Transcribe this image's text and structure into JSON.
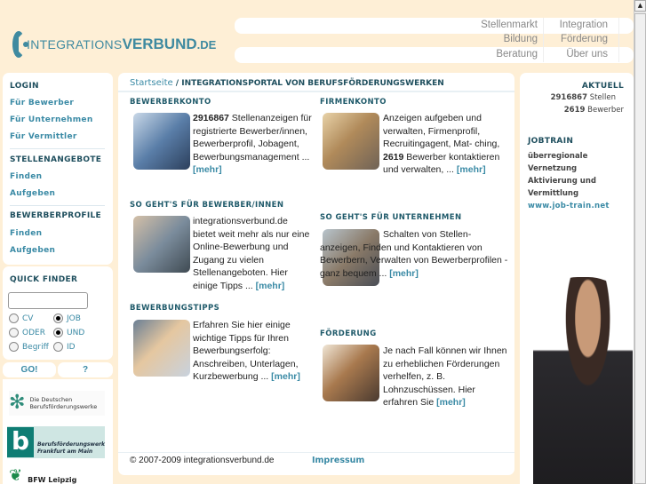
{
  "header": {
    "logo": {
      "part1": "INTEGRATIONS",
      "part2": "VERBUND",
      "part3": ".DE"
    },
    "nav": [
      [
        "Stellenmarkt",
        "Integration"
      ],
      [
        "Bildung",
        "Förderung"
      ],
      [
        "Beratung",
        "Über uns"
      ]
    ]
  },
  "sidebar": {
    "login_heading": "LOGIN",
    "login_links": [
      "Für Bewerber",
      "Für Unternehmen",
      "Für Vermittler"
    ],
    "stellen_heading": "STELLENANGEBOTE",
    "stellen_links": [
      "Finden",
      "Aufgeben"
    ],
    "profile_heading": "BEWERBERPROFILE",
    "profile_links": [
      "Finden",
      "Aufgeben"
    ]
  },
  "quickfinder": {
    "heading": "QUICK FINDER",
    "value": "",
    "options": [
      {
        "label": "CV",
        "checked": false
      },
      {
        "label": "JOB",
        "checked": true
      },
      {
        "label": "ODER",
        "checked": false
      },
      {
        "label": "UND",
        "checked": true
      },
      {
        "label": "Begriff",
        "checked": false
      },
      {
        "label": "ID",
        "checked": false
      }
    ],
    "go": "GO!",
    "help": "?"
  },
  "partners": {
    "p1": [
      "Die Deutschen",
      "Berufsförderungswerke"
    ],
    "p2": [
      "Berufsförderungswerk",
      "Frankfurt am Main"
    ],
    "p3": "BFW Leipzig"
  },
  "breadcrumb": {
    "home": "Startseite",
    "sep": " / ",
    "current": "INTEGRATIONSPORTAL VON BERUFSFÖRDERUNGSWERKEN"
  },
  "sections": {
    "bewerberkonto": {
      "title": "BEWERBERKONTO",
      "bold": "2916867",
      "text": " Stellenanzeigen für registrierte Bewerber/innen, Bewerberprofil, Jobagent, Bewerbungsmanagement ...",
      "more": "[mehr]"
    },
    "firmenkonto": {
      "title": "FIRMENKONTO",
      "text1": "Anzeigen aufgeben und verwalten, Firmenprofil, Recruitingagent, Mat- ching, ",
      "bold": "2619",
      "text2": " Bewerber kontaktieren und verwalten, ... ",
      "more": "[mehr]"
    },
    "sogeht_bew": {
      "title": "SO GEHT'S FÜR BEWERBER/INNEN",
      "text": "integrationsverbund.de bietet weit mehr als nur eine Online-Bewerbung und Zugang zu vielen Stellenangeboten. Hier einige Tipps ... ",
      "more": "[mehr]"
    },
    "sogeht_unt": {
      "title": "SO GEHT'S FÜR UNTERNEHMEN",
      "text": "Schalten von Stellen-anzeigen, Finden und Kontaktieren von Bewerbern, Verwalten von Bewerberprofilen - ganz bequem ... ",
      "more": "[mehr]"
    },
    "tipps": {
      "title": "BEWERBUNGSTIPPS",
      "text": "Erfahren Sie hier einige wichtige Tipps für Ihren Bewerbungserfolg: Anschreiben, Unterlagen, Kurzbewerbung ... ",
      "more": "[mehr]"
    },
    "foerderung": {
      "title": "FÖRDERUNG",
      "text": "Je nach Fall können wir Ihnen zu erheblichen Förderungen verhelfen, z. B. Lohnzuschüssen. Hier erfahren Sie ",
      "more": "[mehr]"
    }
  },
  "footer": {
    "copyright": "© 2007-2009 integrationsverbund.de",
    "impressum": "Impressum"
  },
  "aktuell": {
    "heading": "AKTUELL",
    "stellen_count": "2916867",
    "stellen_label": "Stellen",
    "bewerber_count": "2619",
    "bewerber_label": "Bewerber"
  },
  "jobtrain": {
    "heading": "JOBTRAIN",
    "lines": [
      "überregionale",
      "Vernetzung",
      "Aktivierung und",
      "Vermittlung"
    ],
    "link": "www.job-train.net"
  }
}
